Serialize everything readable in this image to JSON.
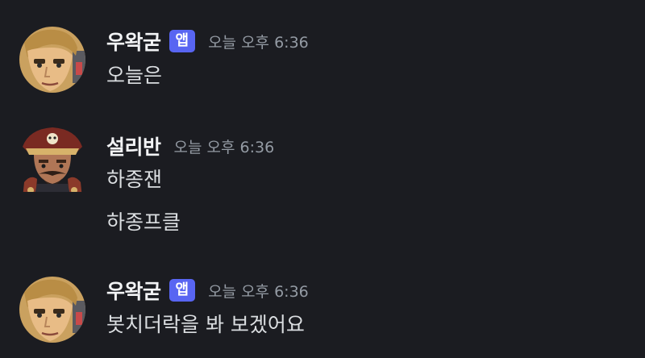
{
  "messages": [
    {
      "author": "우왁굳",
      "badge": "앱",
      "timestamp": "오늘 오후 6:36",
      "avatar_icon": "blonde-man-avatar-icon",
      "lines": [
        "오늘은"
      ]
    },
    {
      "author": "설리반",
      "timestamp": "오늘 오후 6:36",
      "avatar_icon": "pirate-captain-avatar-icon",
      "lines": [
        "하종잰",
        "하종프클"
      ]
    },
    {
      "author": "우왁굳",
      "badge": "앱",
      "timestamp": "오늘 오후 6:36",
      "avatar_icon": "blonde-man-avatar-icon",
      "lines": [
        "봇치더락을 봐 보겠어요"
      ]
    }
  ],
  "colors": {
    "background": "#1b1c21",
    "badge": "#5865f2",
    "username": "#f2f3f5",
    "text": "#dbdee1",
    "timestamp": "#949ba4"
  }
}
